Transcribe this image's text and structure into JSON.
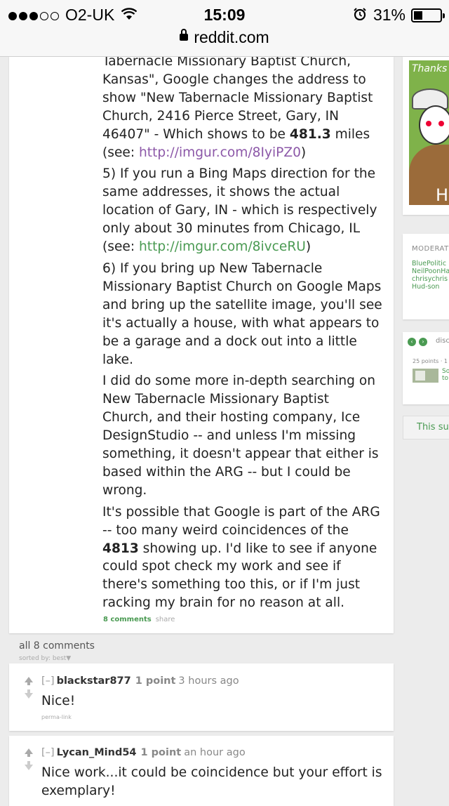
{
  "status_bar": {
    "carrier": "O2-UK",
    "time": "15:09",
    "battery": "31%"
  },
  "url_bar": {
    "domain": "reddit.com"
  },
  "post": {
    "p_intro": "Tabernacle Missionary Baptist Church, Kansas\", Google changes the address to show \"New Tabernacle Missionary Baptist Church, 2416 Pierce Street, Gary, IN 46407\" - Which shows to be ",
    "p_intro_bold": "481.3",
    "p_intro_after": " miles (see: ",
    "link1": "http://imgur.com/8IyiPZ0",
    "p_intro_close": ")",
    "p5": "5) If you run a Bing Maps direction for the same addresses, it shows the actual location of Gary, IN - which is respectively only about 30 minutes from Chicago, IL (see: ",
    "link2": "http://imgur.com/8ivceRU",
    "p5_close": ")",
    "p6": "6) If you bring up New Tabernacle Missionary Baptist Church on Google Maps and bring up the satellite image, you'll see it's actually a house, with what appears to be a garage and a dock out into a little lake.",
    "p7": "I did do some more in-depth searching on New Tabernacle Missionary Baptist Church, and their hosting company, Ice DesignStudio -- and unless I'm missing something, it doesn't appear that either is based within the ARG -- but I could be wrong.",
    "p8_before": "It's possible that Google is part of the ARG -- too many weird coincidences of the ",
    "p8_bold": "4813",
    "p8_after": " showing up. I'd like to see if anyone could spot check my work and see if there's something too this, or if I'm just racking my brain for no reason at all.",
    "comments_link": "8 comments",
    "share_link": "share"
  },
  "sidebar": {
    "ad_text": "Thanks",
    "ad_text2": "Ha",
    "moderators_header": "MODERAT",
    "moderators": [
      "BluePolitic",
      "NeilPoonHa",
      "chrisychris",
      "Hud-son"
    ],
    "discussions_label": "disc",
    "discussion_points": "25 points · 1",
    "discussion_title_1": "So",
    "discussion_title_2": "to",
    "subscribe_text": "This sub"
  },
  "comments_section": {
    "all_label": "all 8 comments",
    "sorted_label": "sorted by: best▼"
  },
  "comments": [
    {
      "collapse": "[–]",
      "author": "blackstar877",
      "points": "1 point",
      "time": "3 hours ago",
      "text": "Nice!",
      "permalink": "perma-link"
    },
    {
      "collapse": "[–]",
      "author": "Lycan_Mind54",
      "points": "1 point",
      "time": "an hour ago",
      "text": "Nice work...it could be coincidence but your effort is exemplary!"
    }
  ],
  "colors": {
    "link_visited": "#8c58a8",
    "link_green": "#4a9a52",
    "background": "#ececec"
  }
}
